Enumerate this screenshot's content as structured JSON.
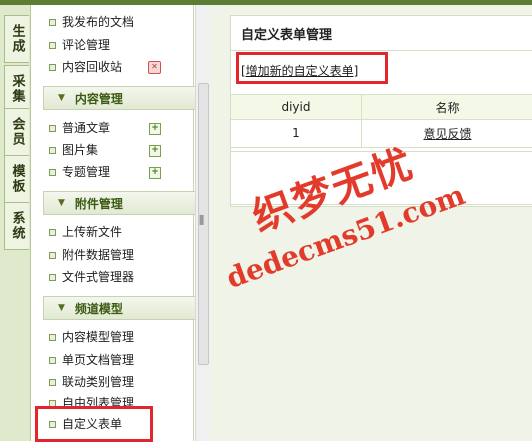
{
  "vertical_tabs": [
    {
      "label": "生成"
    },
    {
      "label": "采集"
    },
    {
      "label": "会员"
    },
    {
      "label": "模板"
    },
    {
      "label": "系统"
    }
  ],
  "menu": {
    "top_items": [
      {
        "label": "我发布的文档"
      },
      {
        "label": "评论管理"
      },
      {
        "label": "内容回收站",
        "icon": "delete-shield-icon"
      }
    ],
    "sections": [
      {
        "title": "内容管理",
        "items": [
          {
            "label": "普通文章",
            "icon": "add-icon"
          },
          {
            "label": "图片集",
            "icon": "add-icon"
          },
          {
            "label": "专题管理",
            "icon": "add-icon"
          }
        ]
      },
      {
        "title": "附件管理",
        "items": [
          {
            "label": "上传新文件"
          },
          {
            "label": "附件数据管理"
          },
          {
            "label": "文件式管理器"
          }
        ]
      },
      {
        "title": "频道模型",
        "items": [
          {
            "label": "内容模型管理"
          },
          {
            "label": "单页文档管理"
          },
          {
            "label": "联动类别管理"
          },
          {
            "label": "自由列表管理"
          },
          {
            "label": "自定义表单"
          }
        ]
      }
    ]
  },
  "main": {
    "title": "自定义表单管理",
    "add_link": "[增加新的自定义表单]",
    "table": {
      "headers": [
        "diyid",
        "名称"
      ],
      "rows": [
        [
          "1",
          "意见反馈"
        ]
      ]
    }
  },
  "watermark": {
    "line1": "织梦无忧",
    "line2": "dedecms51.com"
  },
  "colors": {
    "highlight_box": "#e3262b",
    "section_title": "#3b5a12",
    "topbar": "#5d7d34"
  }
}
